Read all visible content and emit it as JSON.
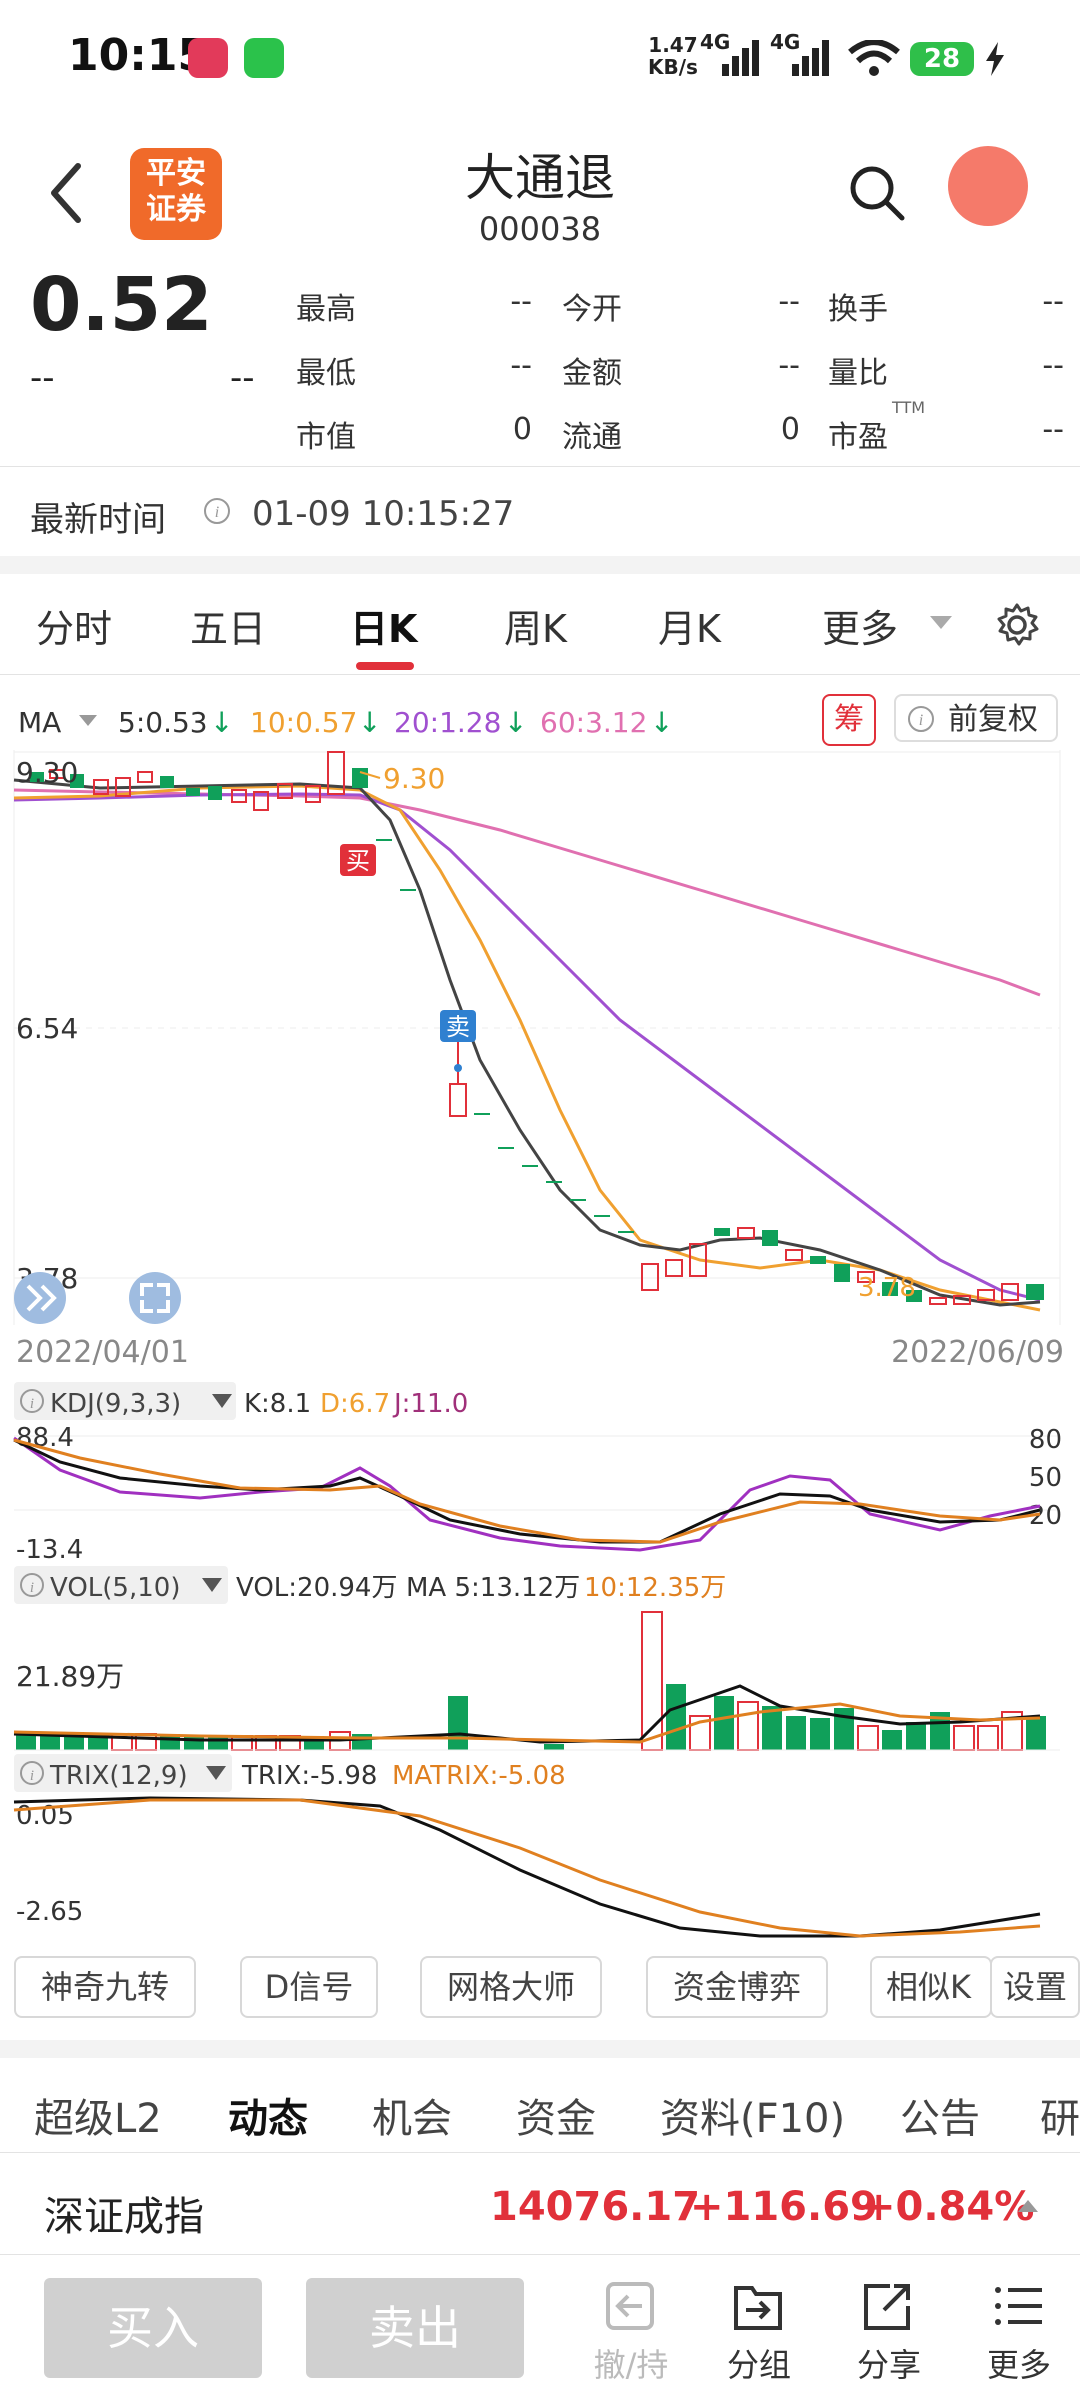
{
  "status": {
    "time": "10:15",
    "net_speed": "1.47\nKB/s",
    "net1": "4G",
    "net2": "4G",
    "battery": "28"
  },
  "header": {
    "title": "大通退",
    "code": "000038",
    "logo_text": "平安\n证券"
  },
  "quote": {
    "price": "0.52",
    "change": "--",
    "change_pct": "--",
    "fields": [
      {
        "label": "最高",
        "value": "--"
      },
      {
        "label": "今开",
        "value": "--"
      },
      {
        "label": "换手",
        "value": "--"
      },
      {
        "label": "最低",
        "value": "--"
      },
      {
        "label": "金额",
        "value": "--"
      },
      {
        "label": "量比",
        "value": "--"
      },
      {
        "label": "市值",
        "value": "0"
      },
      {
        "label": "流通",
        "value": "0"
      },
      {
        "label": "市盈",
        "value": "--"
      }
    ],
    "ttm": "TTM",
    "latest_time_label": "最新时间",
    "latest_time": "01-09 10:15:27"
  },
  "tabs": [
    "分时",
    "五日",
    "日K",
    "周K",
    "月K",
    "更多"
  ],
  "active_tab": "日K",
  "ma_bar": {
    "ma_label": "MA",
    "ma5": "5:0.53",
    "ma10": "10:0.57",
    "ma20": "20:1.28",
    "ma60": "60:3.12",
    "chip_btn": "筹",
    "adjust_btn": "前复权"
  },
  "colors": {
    "up": "#e1303a",
    "down": "#10a05a",
    "ma5": "#333333",
    "ma10": "#f0a030",
    "ma20": "#a050d0",
    "ma60": "#e070b0",
    "accent": "#e1303a"
  },
  "kchart": {
    "y_labels": {
      "top": "9.30",
      "mid": "6.54",
      "low": "3.78"
    },
    "high_marker": "9.30",
    "low_marker": "3.78",
    "buy_label": "买",
    "sell_label": "卖",
    "start_date": "2022/04/01",
    "end_date": "2022/06/09"
  },
  "kdj": {
    "label": "KDJ(9,3,3)",
    "k": "K:8.1",
    "d": "D:6.7",
    "j": "J:11.0",
    "y_top": "88.4",
    "y_bottom": "-13.4",
    "r80": "80",
    "r50": "50",
    "r20": "20"
  },
  "vol": {
    "label": "VOL(5,10)",
    "vol": "VOL:20.94万",
    "ma5": "MA 5:13.12万",
    "ma10": "10:12.35万",
    "y_label": "21.89万"
  },
  "trix": {
    "label": "TRIX(12,9)",
    "trix": "TRIX:-5.98",
    "matrix": "MATRIX:-5.08",
    "y_top": "0.05",
    "y_bottom": "-2.65"
  },
  "tools": [
    "神奇九转",
    "D信号",
    "网格大师",
    "资金博弈",
    "相似K",
    "设置"
  ],
  "bottom_tabs": [
    "超级L2",
    "动态",
    "机会",
    "资金",
    "资料(F10)",
    "公告",
    "研"
  ],
  "active_bottom_tab": "动态",
  "index": {
    "name": "深证成指",
    "value": "14076.17",
    "change": "+116.69",
    "pct": "+0.84%"
  },
  "actions": {
    "buy": "买入",
    "sell": "卖出",
    "hold": "撤/持",
    "group": "分组",
    "share": "分享",
    "more": "更多"
  }
}
